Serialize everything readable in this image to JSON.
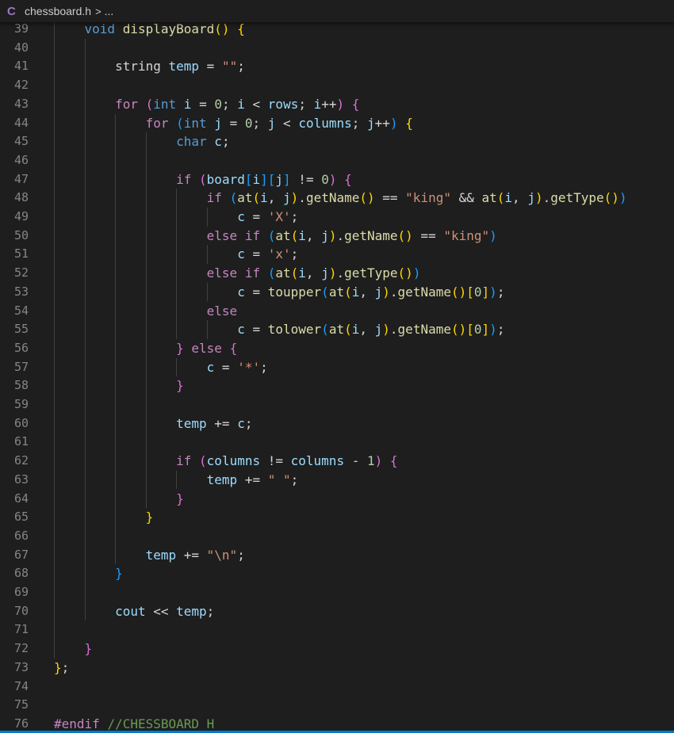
{
  "breadcrumb": {
    "file_icon": "C",
    "file_name": "chessboard.h",
    "separator": ">",
    "ellipsis": "..."
  },
  "colors": {
    "background": "#1e1e1e",
    "keyword": "#569cd6",
    "control": "#c586c0",
    "function": "#dcdcaa",
    "variable": "#9cdcfe",
    "string": "#ce9178",
    "number": "#b5cea8",
    "comment": "#6a9955",
    "bracket_level1": "#ffd700",
    "bracket_level2": "#da70d6",
    "bracket_level3": "#179fff",
    "status_bar": "#007acc"
  },
  "editor": {
    "lines": [
      {
        "n": "39",
        "indent": 1,
        "tokens": [
          [
            "kw",
            "void"
          ],
          [
            "op",
            " "
          ],
          [
            "fn",
            "displayBoard"
          ],
          [
            "b1",
            "()"
          ],
          [
            "op",
            " "
          ],
          [
            "b1",
            "{"
          ]
        ]
      },
      {
        "n": "40",
        "indent": 0,
        "tokens": []
      },
      {
        "n": "41",
        "indent": 2,
        "tokens": [
          [
            "op",
            "string "
          ],
          [
            "var",
            "temp"
          ],
          [
            "op",
            " = "
          ],
          [
            "str",
            "\"\""
          ],
          [
            "op",
            ";"
          ]
        ]
      },
      {
        "n": "42",
        "indent": 0,
        "tokens": []
      },
      {
        "n": "43",
        "indent": 2,
        "tokens": [
          [
            "ctl",
            "for"
          ],
          [
            "op",
            " "
          ],
          [
            "b2",
            "("
          ],
          [
            "kw",
            "int"
          ],
          [
            "op",
            " "
          ],
          [
            "var",
            "i"
          ],
          [
            "op",
            " = "
          ],
          [
            "num",
            "0"
          ],
          [
            "op",
            "; "
          ],
          [
            "var",
            "i"
          ],
          [
            "op",
            " < "
          ],
          [
            "var",
            "rows"
          ],
          [
            "op",
            "; "
          ],
          [
            "var",
            "i"
          ],
          [
            "op",
            "++"
          ],
          [
            "b2",
            ")"
          ],
          [
            "op",
            " "
          ],
          [
            "b2",
            "{"
          ]
        ]
      },
      {
        "n": "44",
        "indent": 3,
        "tokens": [
          [
            "ctl",
            "for"
          ],
          [
            "op",
            " "
          ],
          [
            "b3",
            "("
          ],
          [
            "kw",
            "int"
          ],
          [
            "op",
            " "
          ],
          [
            "var",
            "j"
          ],
          [
            "op",
            " = "
          ],
          [
            "num",
            "0"
          ],
          [
            "op",
            "; "
          ],
          [
            "var",
            "j"
          ],
          [
            "op",
            " < "
          ],
          [
            "var",
            "columns"
          ],
          [
            "op",
            "; "
          ],
          [
            "var",
            "j"
          ],
          [
            "op",
            "++"
          ],
          [
            "b3",
            ")"
          ],
          [
            "op",
            " "
          ],
          [
            "b1",
            "{"
          ]
        ]
      },
      {
        "n": "45",
        "indent": 4,
        "tokens": [
          [
            "kw",
            "char"
          ],
          [
            "op",
            " "
          ],
          [
            "var",
            "c"
          ],
          [
            "op",
            ";"
          ]
        ]
      },
      {
        "n": "46",
        "indent": 0,
        "tokens": []
      },
      {
        "n": "47",
        "indent": 4,
        "tokens": [
          [
            "ctl",
            "if"
          ],
          [
            "op",
            " "
          ],
          [
            "b2",
            "("
          ],
          [
            "var",
            "board"
          ],
          [
            "b3",
            "["
          ],
          [
            "var",
            "i"
          ],
          [
            "b3",
            "]["
          ],
          [
            "var",
            "j"
          ],
          [
            "b3",
            "]"
          ],
          [
            "op",
            " != "
          ],
          [
            "num",
            "0"
          ],
          [
            "b2",
            ")"
          ],
          [
            "op",
            " "
          ],
          [
            "b2",
            "{"
          ]
        ]
      },
      {
        "n": "48",
        "indent": 5,
        "tokens": [
          [
            "ctl",
            "if"
          ],
          [
            "op",
            " "
          ],
          [
            "b3",
            "("
          ],
          [
            "fn",
            "at"
          ],
          [
            "b1",
            "("
          ],
          [
            "var",
            "i"
          ],
          [
            "op",
            ", "
          ],
          [
            "var",
            "j"
          ],
          [
            "b1",
            ")"
          ],
          [
            "op",
            "."
          ],
          [
            "fn",
            "getName"
          ],
          [
            "b1",
            "()"
          ],
          [
            "op",
            " == "
          ],
          [
            "str",
            "\"king\""
          ],
          [
            "op",
            " && "
          ],
          [
            "fn",
            "at"
          ],
          [
            "b1",
            "("
          ],
          [
            "var",
            "i"
          ],
          [
            "op",
            ", "
          ],
          [
            "var",
            "j"
          ],
          [
            "b1",
            ")"
          ],
          [
            "op",
            "."
          ],
          [
            "fn",
            "getType"
          ],
          [
            "b1",
            "()"
          ],
          [
            "b3",
            ")"
          ]
        ]
      },
      {
        "n": "49",
        "indent": 6,
        "tokens": [
          [
            "var",
            "c"
          ],
          [
            "op",
            " = "
          ],
          [
            "str",
            "'X'"
          ],
          [
            "op",
            ";"
          ]
        ]
      },
      {
        "n": "50",
        "indent": 5,
        "tokens": [
          [
            "ctl",
            "else"
          ],
          [
            "op",
            " "
          ],
          [
            "ctl",
            "if"
          ],
          [
            "op",
            " "
          ],
          [
            "b3",
            "("
          ],
          [
            "fn",
            "at"
          ],
          [
            "b1",
            "("
          ],
          [
            "var",
            "i"
          ],
          [
            "op",
            ", "
          ],
          [
            "var",
            "j"
          ],
          [
            "b1",
            ")"
          ],
          [
            "op",
            "."
          ],
          [
            "fn",
            "getName"
          ],
          [
            "b1",
            "()"
          ],
          [
            "op",
            " == "
          ],
          [
            "str",
            "\"king\""
          ],
          [
            "b3",
            ")"
          ]
        ]
      },
      {
        "n": "51",
        "indent": 6,
        "tokens": [
          [
            "var",
            "c"
          ],
          [
            "op",
            " = "
          ],
          [
            "str",
            "'x'"
          ],
          [
            "op",
            ";"
          ]
        ]
      },
      {
        "n": "52",
        "indent": 5,
        "tokens": [
          [
            "ctl",
            "else"
          ],
          [
            "op",
            " "
          ],
          [
            "ctl",
            "if"
          ],
          [
            "op",
            " "
          ],
          [
            "b3",
            "("
          ],
          [
            "fn",
            "at"
          ],
          [
            "b1",
            "("
          ],
          [
            "var",
            "i"
          ],
          [
            "op",
            ", "
          ],
          [
            "var",
            "j"
          ],
          [
            "b1",
            ")"
          ],
          [
            "op",
            "."
          ],
          [
            "fn",
            "getType"
          ],
          [
            "b1",
            "()"
          ],
          [
            "b3",
            ")"
          ]
        ]
      },
      {
        "n": "53",
        "indent": 6,
        "tokens": [
          [
            "var",
            "c"
          ],
          [
            "op",
            " = "
          ],
          [
            "fn",
            "toupper"
          ],
          [
            "b3",
            "("
          ],
          [
            "fn",
            "at"
          ],
          [
            "b1",
            "("
          ],
          [
            "var",
            "i"
          ],
          [
            "op",
            ", "
          ],
          [
            "var",
            "j"
          ],
          [
            "b1",
            ")"
          ],
          [
            "op",
            "."
          ],
          [
            "fn",
            "getName"
          ],
          [
            "b1",
            "()"
          ],
          [
            "b1",
            "["
          ],
          [
            "num",
            "0"
          ],
          [
            "b1",
            "]"
          ],
          [
            "b3",
            ")"
          ],
          [
            "op",
            ";"
          ]
        ]
      },
      {
        "n": "54",
        "indent": 5,
        "tokens": [
          [
            "ctl",
            "else"
          ]
        ]
      },
      {
        "n": "55",
        "indent": 6,
        "tokens": [
          [
            "var",
            "c"
          ],
          [
            "op",
            " = "
          ],
          [
            "fn",
            "tolower"
          ],
          [
            "b3",
            "("
          ],
          [
            "fn",
            "at"
          ],
          [
            "b1",
            "("
          ],
          [
            "var",
            "i"
          ],
          [
            "op",
            ", "
          ],
          [
            "var",
            "j"
          ],
          [
            "b1",
            ")"
          ],
          [
            "op",
            "."
          ],
          [
            "fn",
            "getName"
          ],
          [
            "b1",
            "()"
          ],
          [
            "b1",
            "["
          ],
          [
            "num",
            "0"
          ],
          [
            "b1",
            "]"
          ],
          [
            "b3",
            ")"
          ],
          [
            "op",
            ";"
          ]
        ]
      },
      {
        "n": "56",
        "indent": 4,
        "tokens": [
          [
            "b2",
            "}"
          ],
          [
            "op",
            " "
          ],
          [
            "ctl",
            "else"
          ],
          [
            "op",
            " "
          ],
          [
            "b2",
            "{"
          ]
        ]
      },
      {
        "n": "57",
        "indent": 5,
        "tokens": [
          [
            "var",
            "c"
          ],
          [
            "op",
            " = "
          ],
          [
            "str",
            "'*'"
          ],
          [
            "op",
            ";"
          ]
        ]
      },
      {
        "n": "58",
        "indent": 4,
        "tokens": [
          [
            "b2",
            "}"
          ]
        ]
      },
      {
        "n": "59",
        "indent": 0,
        "tokens": []
      },
      {
        "n": "60",
        "indent": 4,
        "tokens": [
          [
            "var",
            "temp"
          ],
          [
            "op",
            " += "
          ],
          [
            "var",
            "c"
          ],
          [
            "op",
            ";"
          ]
        ]
      },
      {
        "n": "61",
        "indent": 0,
        "tokens": []
      },
      {
        "n": "62",
        "indent": 4,
        "tokens": [
          [
            "ctl",
            "if"
          ],
          [
            "op",
            " "
          ],
          [
            "b2",
            "("
          ],
          [
            "var",
            "columns"
          ],
          [
            "op",
            " != "
          ],
          [
            "var",
            "columns"
          ],
          [
            "op",
            " - "
          ],
          [
            "num",
            "1"
          ],
          [
            "b2",
            ")"
          ],
          [
            "op",
            " "
          ],
          [
            "b2",
            "{"
          ]
        ]
      },
      {
        "n": "63",
        "indent": 5,
        "tokens": [
          [
            "var",
            "temp"
          ],
          [
            "op",
            " += "
          ],
          [
            "str",
            "\" \""
          ],
          [
            "op",
            ";"
          ]
        ]
      },
      {
        "n": "64",
        "indent": 4,
        "tokens": [
          [
            "b2",
            "}"
          ]
        ]
      },
      {
        "n": "65",
        "indent": 3,
        "tokens": [
          [
            "b1",
            "}"
          ]
        ]
      },
      {
        "n": "66",
        "indent": 0,
        "tokens": []
      },
      {
        "n": "67",
        "indent": 3,
        "tokens": [
          [
            "var",
            "temp"
          ],
          [
            "op",
            " += "
          ],
          [
            "str",
            "\"\\n\""
          ],
          [
            "op",
            ";"
          ]
        ]
      },
      {
        "n": "68",
        "indent": 2,
        "tokens": [
          [
            "b3",
            "}"
          ]
        ]
      },
      {
        "n": "69",
        "indent": 0,
        "tokens": []
      },
      {
        "n": "70",
        "indent": 2,
        "tokens": [
          [
            "var",
            "cout"
          ],
          [
            "op",
            " << "
          ],
          [
            "var",
            "temp"
          ],
          [
            "op",
            ";"
          ]
        ]
      },
      {
        "n": "71",
        "indent": 0,
        "tokens": []
      },
      {
        "n": "72",
        "indent": 1,
        "tokens": [
          [
            "b2",
            "}"
          ]
        ]
      },
      {
        "n": "73",
        "indent": 0,
        "tokens": [
          [
            "b1",
            "}"
          ],
          [
            "op",
            ";"
          ]
        ]
      },
      {
        "n": "74",
        "indent": 0,
        "tokens": []
      },
      {
        "n": "75",
        "indent": 0,
        "tokens": []
      },
      {
        "n": "76",
        "indent": 0,
        "tokens": [
          [
            "ctl",
            "#endif"
          ],
          [
            "op",
            " "
          ],
          [
            "com",
            "//CHESSBOARD_H"
          ]
        ]
      }
    ]
  }
}
